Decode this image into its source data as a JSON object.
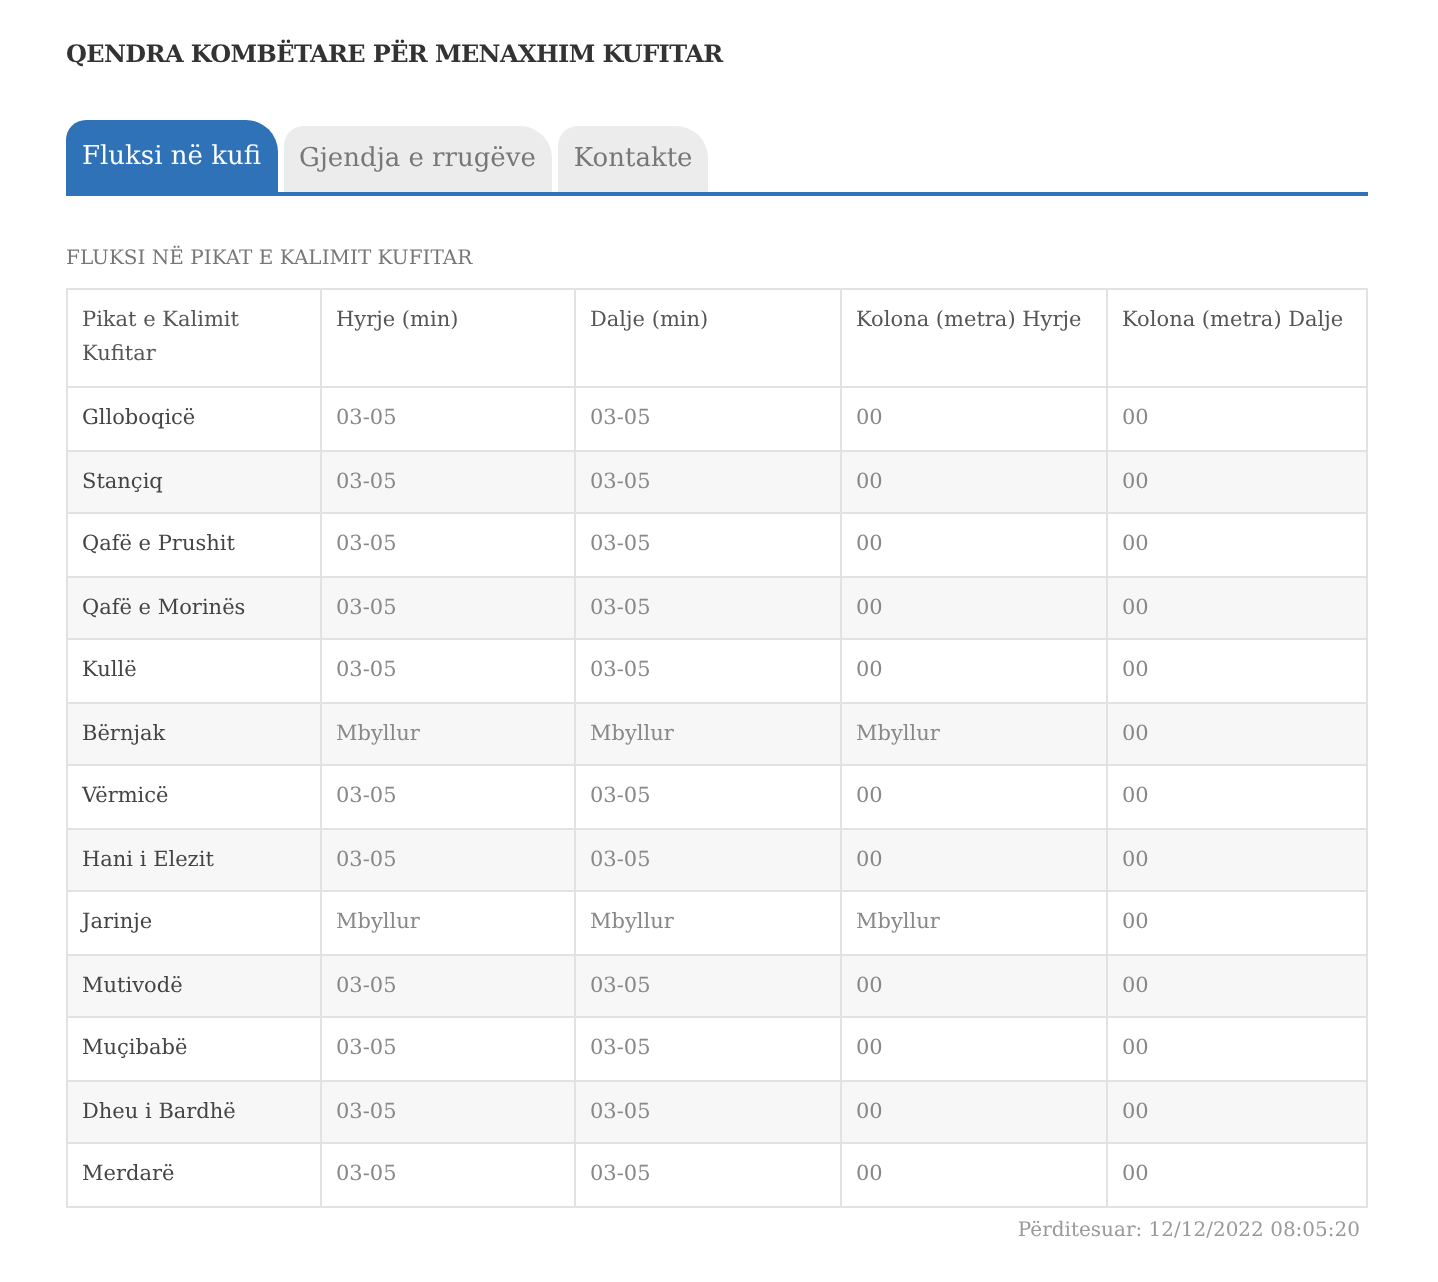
{
  "title": "QENDRA KOMBËTARE PËR MENAXHIM KUFITAR",
  "tabs": [
    {
      "label": "Fluksi në kufi",
      "selected": true
    },
    {
      "label": "Gjendja e rrugëve",
      "selected": false
    },
    {
      "label": "Kontakte",
      "selected": false
    }
  ],
  "section_title": "FLUKSI NË PIKAT E KALIMIT KUFITAR",
  "table": {
    "columns": [
      "Pikat e Kalimit Kufitar",
      "Hyrje (min)",
      "Dalje (min)",
      "Kolona (metra) Hyrje",
      "Kolona (metra) Dalje"
    ],
    "rows": [
      [
        "Glloboqicë",
        "03-05",
        "03-05",
        "00",
        "00"
      ],
      [
        "Stançiq",
        "03-05",
        "03-05",
        "00",
        "00"
      ],
      [
        "Qafë e Prushit",
        "03-05",
        "03-05",
        "00",
        "00"
      ],
      [
        "Qafë e Morinës",
        "03-05",
        "03-05",
        "00",
        "00"
      ],
      [
        "Kullë",
        "03-05",
        "03-05",
        "00",
        "00"
      ],
      [
        "Bërnjak",
        "Mbyllur",
        "Mbyllur",
        "Mbyllur",
        "00"
      ],
      [
        "Vërmicë",
        "03-05",
        "03-05",
        "00",
        "00"
      ],
      [
        "Hani i Elezit",
        "03-05",
        "03-05",
        "00",
        "00"
      ],
      [
        "Jarinje",
        "Mbyllur",
        "Mbyllur",
        "Mbyllur",
        "00"
      ],
      [
        "Mutivodë",
        "03-05",
        "03-05",
        "00",
        "00"
      ],
      [
        "Muçibabë",
        "03-05",
        "03-05",
        "00",
        "00"
      ],
      [
        "Dheu i Bardhë",
        "03-05",
        "03-05",
        "00",
        "00"
      ],
      [
        "Merdarë",
        "03-05",
        "03-05",
        "00",
        "00"
      ]
    ]
  },
  "updated": "Përditesuar: 12/12/2022 08:05:20"
}
